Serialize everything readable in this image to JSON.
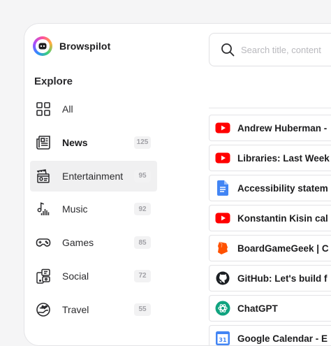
{
  "app": {
    "name": "Browspilot"
  },
  "search": {
    "placeholder": "Search title, content"
  },
  "sidebar": {
    "section_title": "Explore",
    "items": [
      {
        "label": "All",
        "count": "",
        "icon": "grid-icon",
        "active": false,
        "bold": false
      },
      {
        "label": "News",
        "count": "125",
        "icon": "newspaper-icon",
        "active": false,
        "bold": true
      },
      {
        "label": "Entertainment",
        "count": "95",
        "icon": "entertainment-icon",
        "active": true,
        "bold": false
      },
      {
        "label": "Music",
        "count": "92",
        "icon": "music-icon",
        "active": false,
        "bold": false
      },
      {
        "label": "Games",
        "count": "85",
        "icon": "gamepad-icon",
        "active": false,
        "bold": false
      },
      {
        "label": "Social",
        "count": "72",
        "icon": "social-icon",
        "active": false,
        "bold": false
      },
      {
        "label": "Travel",
        "count": "55",
        "icon": "travel-icon",
        "active": false,
        "bold": false
      }
    ]
  },
  "results": [
    {
      "title": "Andrew Huberman -",
      "icon": "youtube-icon"
    },
    {
      "title": "Libraries: Last Week",
      "icon": "youtube-icon"
    },
    {
      "title": "Accessibility statem",
      "icon": "google-docs-icon"
    },
    {
      "title": "Konstantin Kisin cal",
      "icon": "youtube-icon"
    },
    {
      "title": "BoardGameGeek | C",
      "icon": "boardgamegeek-icon"
    },
    {
      "title": "GitHub: Let's build f",
      "icon": "github-icon"
    },
    {
      "title": "ChatGPT",
      "icon": "chatgpt-icon"
    },
    {
      "title": "Google Calendar - E",
      "icon": "google-calendar-icon"
    }
  ],
  "colors": {
    "youtube": "#ff0000",
    "google_docs": "#4285f4",
    "boardgamegeek": "#ff5100",
    "github": "#1b1f23",
    "chatgpt": "#10a37f",
    "calendar": "#4285f4"
  }
}
